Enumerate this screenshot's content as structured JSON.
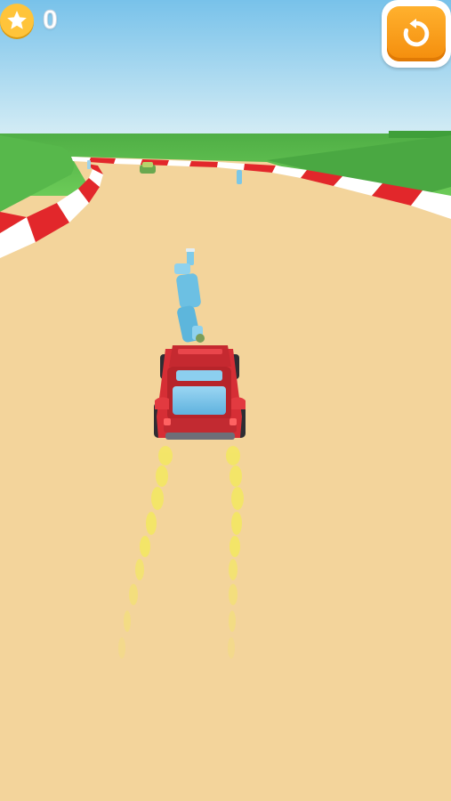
{
  "hud": {
    "star_count": "0",
    "star_icon": "star-icon",
    "restart_icon": "restart-icon"
  },
  "colors": {
    "sky_top": "#7ec6ec",
    "sky_horizon": "#d9eff7",
    "grass": "#5bbf4f",
    "track": "#f3d49b",
    "curb_red": "#e2272b",
    "curb_white": "#ffffff",
    "car_body": "#d62e35",
    "car_window": "#79c6ee",
    "bottle": "#6cc0e3",
    "exhaust": "#f3e860",
    "star_badge": "#ffc43a",
    "restart_button": "#f7a01d"
  }
}
